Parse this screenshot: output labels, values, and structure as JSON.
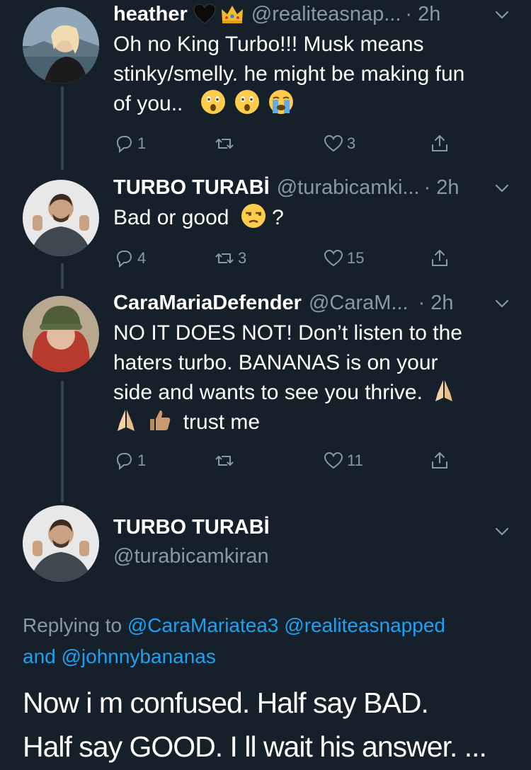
{
  "tweets": [
    {
      "name": "heather",
      "handle": "@realiteasnap...",
      "time": "· 2h",
      "lines": [
        "Oh no King Turbo!!! Musk means",
        "stinky/smelly. he might be making fun",
        "of you.."
      ],
      "emojis": [
        "astonished-face",
        "astonished-face",
        "crying-face"
      ],
      "reply_count": "1",
      "retweet_count": "",
      "like_count": "3"
    },
    {
      "name": "TURBO TURABİ",
      "handle": "@turabicamki...",
      "time": "· 2h",
      "text_before": "Bad or good",
      "text_after": "?",
      "emojis": [
        "unamused-face"
      ],
      "reply_count": "4",
      "retweet_count": "3",
      "like_count": "15"
    },
    {
      "name": "CaraMariaDefender",
      "handle": "@CaraM...",
      "time": "· 2h",
      "lines": [
        "NO IT DOES NOT! Don’t listen to the",
        "haters turbo. BANANAS is on your",
        "side and wants to see you thrive."
      ],
      "last_line": "trust me",
      "emojis": [
        "folded-hands",
        "folded-hands",
        "thumbs-up"
      ],
      "reply_count": "1",
      "retweet_count": "",
      "like_count": "11"
    }
  ],
  "main_tweet": {
    "name": "TURBO TURABİ",
    "handle": "@turabicamkiran",
    "replying_prefix": "Replying to",
    "mention_1": "@CaraMariatea3",
    "mention_2": "@realiteasnapped",
    "and_word": "and",
    "mention_3": "@johnnybananas",
    "text_line1": "Now i m confused. Half say BAD.",
    "text_line2": "Half say GOOD. I ll wait his answer. ..."
  },
  "colors": {
    "background": "#15202b",
    "secondary_text": "#8899a6",
    "link": "#1da1f2",
    "thread_line": "#38444d"
  }
}
